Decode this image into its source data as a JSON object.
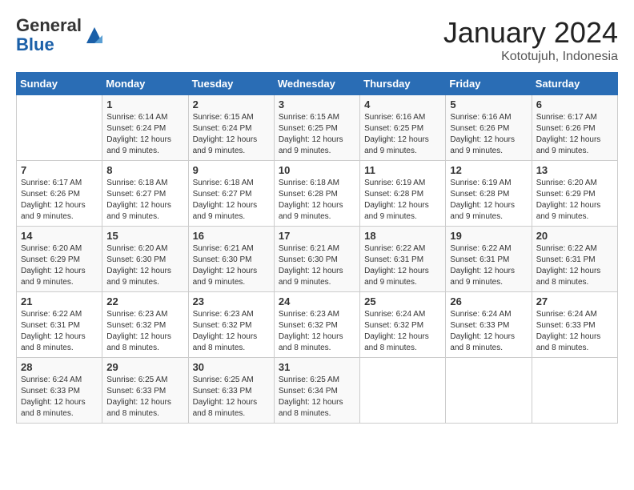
{
  "logo": {
    "general": "General",
    "blue": "Blue"
  },
  "title": "January 2024",
  "subtitle": "Kototujuh, Indonesia",
  "days_of_week": [
    "Sunday",
    "Monday",
    "Tuesday",
    "Wednesday",
    "Thursday",
    "Friday",
    "Saturday"
  ],
  "weeks": [
    [
      {
        "day": "",
        "info": ""
      },
      {
        "day": "1",
        "info": "Sunrise: 6:14 AM\nSunset: 6:24 PM\nDaylight: 12 hours\nand 9 minutes."
      },
      {
        "day": "2",
        "info": "Sunrise: 6:15 AM\nSunset: 6:24 PM\nDaylight: 12 hours\nand 9 minutes."
      },
      {
        "day": "3",
        "info": "Sunrise: 6:15 AM\nSunset: 6:25 PM\nDaylight: 12 hours\nand 9 minutes."
      },
      {
        "day": "4",
        "info": "Sunrise: 6:16 AM\nSunset: 6:25 PM\nDaylight: 12 hours\nand 9 minutes."
      },
      {
        "day": "5",
        "info": "Sunrise: 6:16 AM\nSunset: 6:26 PM\nDaylight: 12 hours\nand 9 minutes."
      },
      {
        "day": "6",
        "info": "Sunrise: 6:17 AM\nSunset: 6:26 PM\nDaylight: 12 hours\nand 9 minutes."
      }
    ],
    [
      {
        "day": "7",
        "info": "Sunrise: 6:17 AM\nSunset: 6:26 PM\nDaylight: 12 hours\nand 9 minutes."
      },
      {
        "day": "8",
        "info": "Sunrise: 6:18 AM\nSunset: 6:27 PM\nDaylight: 12 hours\nand 9 minutes."
      },
      {
        "day": "9",
        "info": "Sunrise: 6:18 AM\nSunset: 6:27 PM\nDaylight: 12 hours\nand 9 minutes."
      },
      {
        "day": "10",
        "info": "Sunrise: 6:18 AM\nSunset: 6:28 PM\nDaylight: 12 hours\nand 9 minutes."
      },
      {
        "day": "11",
        "info": "Sunrise: 6:19 AM\nSunset: 6:28 PM\nDaylight: 12 hours\nand 9 minutes."
      },
      {
        "day": "12",
        "info": "Sunrise: 6:19 AM\nSunset: 6:28 PM\nDaylight: 12 hours\nand 9 minutes."
      },
      {
        "day": "13",
        "info": "Sunrise: 6:20 AM\nSunset: 6:29 PM\nDaylight: 12 hours\nand 9 minutes."
      }
    ],
    [
      {
        "day": "14",
        "info": "Sunrise: 6:20 AM\nSunset: 6:29 PM\nDaylight: 12 hours\nand 9 minutes."
      },
      {
        "day": "15",
        "info": "Sunrise: 6:20 AM\nSunset: 6:30 PM\nDaylight: 12 hours\nand 9 minutes."
      },
      {
        "day": "16",
        "info": "Sunrise: 6:21 AM\nSunset: 6:30 PM\nDaylight: 12 hours\nand 9 minutes."
      },
      {
        "day": "17",
        "info": "Sunrise: 6:21 AM\nSunset: 6:30 PM\nDaylight: 12 hours\nand 9 minutes."
      },
      {
        "day": "18",
        "info": "Sunrise: 6:22 AM\nSunset: 6:31 PM\nDaylight: 12 hours\nand 9 minutes."
      },
      {
        "day": "19",
        "info": "Sunrise: 6:22 AM\nSunset: 6:31 PM\nDaylight: 12 hours\nand 9 minutes."
      },
      {
        "day": "20",
        "info": "Sunrise: 6:22 AM\nSunset: 6:31 PM\nDaylight: 12 hours\nand 8 minutes."
      }
    ],
    [
      {
        "day": "21",
        "info": "Sunrise: 6:22 AM\nSunset: 6:31 PM\nDaylight: 12 hours\nand 8 minutes."
      },
      {
        "day": "22",
        "info": "Sunrise: 6:23 AM\nSunset: 6:32 PM\nDaylight: 12 hours\nand 8 minutes."
      },
      {
        "day": "23",
        "info": "Sunrise: 6:23 AM\nSunset: 6:32 PM\nDaylight: 12 hours\nand 8 minutes."
      },
      {
        "day": "24",
        "info": "Sunrise: 6:23 AM\nSunset: 6:32 PM\nDaylight: 12 hours\nand 8 minutes."
      },
      {
        "day": "25",
        "info": "Sunrise: 6:24 AM\nSunset: 6:32 PM\nDaylight: 12 hours\nand 8 minutes."
      },
      {
        "day": "26",
        "info": "Sunrise: 6:24 AM\nSunset: 6:33 PM\nDaylight: 12 hours\nand 8 minutes."
      },
      {
        "day": "27",
        "info": "Sunrise: 6:24 AM\nSunset: 6:33 PM\nDaylight: 12 hours\nand 8 minutes."
      }
    ],
    [
      {
        "day": "28",
        "info": "Sunrise: 6:24 AM\nSunset: 6:33 PM\nDaylight: 12 hours\nand 8 minutes."
      },
      {
        "day": "29",
        "info": "Sunrise: 6:25 AM\nSunset: 6:33 PM\nDaylight: 12 hours\nand 8 minutes."
      },
      {
        "day": "30",
        "info": "Sunrise: 6:25 AM\nSunset: 6:33 PM\nDaylight: 12 hours\nand 8 minutes."
      },
      {
        "day": "31",
        "info": "Sunrise: 6:25 AM\nSunset: 6:34 PM\nDaylight: 12 hours\nand 8 minutes."
      },
      {
        "day": "",
        "info": ""
      },
      {
        "day": "",
        "info": ""
      },
      {
        "day": "",
        "info": ""
      }
    ]
  ]
}
